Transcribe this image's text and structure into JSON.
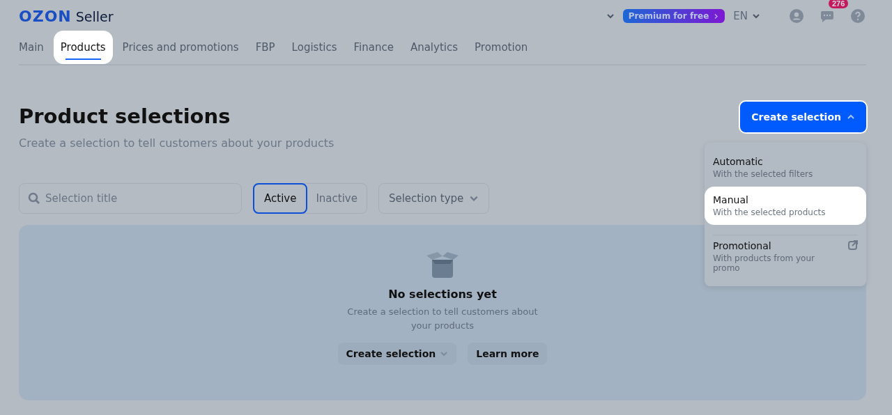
{
  "header": {
    "logo": "OZON",
    "product": "Seller",
    "premium": "Premium for free",
    "language": "EN",
    "notifications": "276"
  },
  "tabs": [
    {
      "label": "Main",
      "selected": false
    },
    {
      "label": "Products",
      "selected": true
    },
    {
      "label": "Prices and promotions",
      "selected": false
    },
    {
      "label": "FBP",
      "selected": false
    },
    {
      "label": "Logistics",
      "selected": false
    },
    {
      "label": "Finance",
      "selected": false
    },
    {
      "label": "Analytics",
      "selected": false
    },
    {
      "label": "Promotion",
      "selected": false
    }
  ],
  "page": {
    "title": "Product selections",
    "subtitle": "Create a selection to tell customers about your products",
    "create_button": "Create selection",
    "expanded": true
  },
  "menu": [
    {
      "title": "Automatic",
      "description": "With the selected filters",
      "selected": false,
      "kind": "plain"
    },
    {
      "title": "Manual",
      "description": "With the selected products",
      "selected": true,
      "kind": "plain"
    },
    {
      "title": "Promotional",
      "description": "With products from your promo",
      "selected": false,
      "kind": "external"
    }
  ],
  "filters": {
    "search": {
      "placeholder": "Selection title"
    },
    "status": [
      {
        "label": "Active",
        "selected": true
      },
      {
        "label": "Inactive",
        "selected": false
      }
    ],
    "type": "Selection type"
  },
  "empty": {
    "title": "No selections yet",
    "text": "Create a selection to tell customers about your products",
    "buttons": [
      "Create selection",
      "Learn more"
    ]
  }
}
